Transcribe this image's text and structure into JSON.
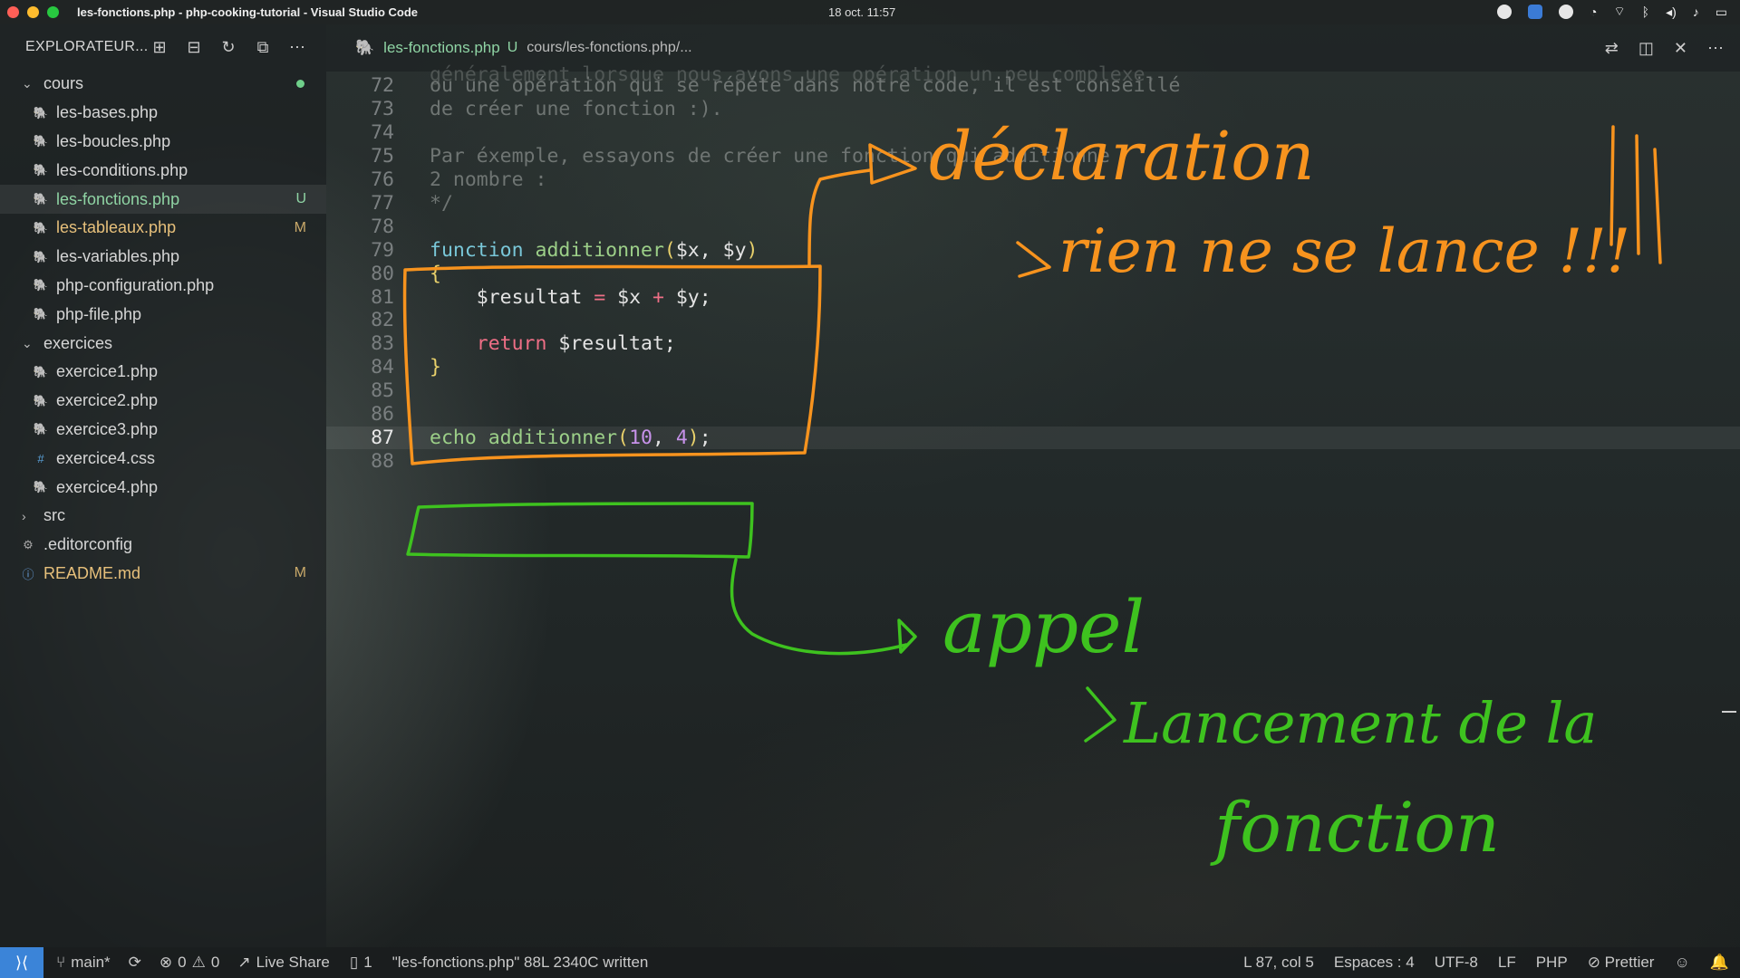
{
  "window": {
    "title": "les-fonctions.php - php-cooking-tutorial - Visual Studio Code",
    "clock": "18 oct.  11:57",
    "traffic_colors": [
      "#ff5f57",
      "#febc2e",
      "#28c840"
    ]
  },
  "sidebar": {
    "header": "EXPLORATEUR...",
    "actions": [
      "new-file-icon",
      "new-folder-icon",
      "refresh-icon",
      "collapse-icon",
      "more-icon"
    ],
    "folders": [
      {
        "name": "cours",
        "expanded": true,
        "files": [
          {
            "name": "les-bases.php",
            "type": "php",
            "badge": ""
          },
          {
            "name": "les-boucles.php",
            "type": "php",
            "badge": ""
          },
          {
            "name": "les-conditions.php",
            "type": "php",
            "badge": ""
          },
          {
            "name": "les-fonctions.php",
            "type": "php",
            "badge": "U"
          },
          {
            "name": "les-tableaux.php",
            "type": "php",
            "badge": "M"
          },
          {
            "name": "les-variables.php",
            "type": "php",
            "badge": ""
          },
          {
            "name": "php-configuration.php",
            "type": "php",
            "badge": ""
          },
          {
            "name": "php-file.php",
            "type": "php",
            "badge": ""
          }
        ]
      },
      {
        "name": "exercices",
        "expanded": true,
        "files": [
          {
            "name": "exercice1.php",
            "type": "php",
            "badge": ""
          },
          {
            "name": "exercice2.php",
            "type": "php",
            "badge": ""
          },
          {
            "name": "exercice3.php",
            "type": "php",
            "badge": ""
          },
          {
            "name": "exercice4.css",
            "type": "css",
            "badge": ""
          },
          {
            "name": "exercice4.php",
            "type": "php",
            "badge": ""
          }
        ]
      },
      {
        "name": "src",
        "expanded": false,
        "files": []
      }
    ],
    "root_files": [
      {
        "name": ".editorconfig",
        "type": "config",
        "badge": ""
      },
      {
        "name": "README.md",
        "type": "info",
        "badge": "M"
      }
    ]
  },
  "tab": {
    "name": "les-fonctions.php",
    "flag": "U",
    "path": "cours/les-fonctions.php/..."
  },
  "code": {
    "lines": [
      {
        "n": "72",
        "parts": [
          [
            "cm",
            "ou une opération qui se répéte dans notre code, il est conseillé"
          ]
        ]
      },
      {
        "n": "73",
        "parts": [
          [
            "cm",
            "de créer une fonction :)."
          ]
        ]
      },
      {
        "n": "74",
        "parts": []
      },
      {
        "n": "75",
        "parts": [
          [
            "cm",
            "Par éxemple, essayons de créer une fonction qui additionne"
          ]
        ]
      },
      {
        "n": "76",
        "parts": [
          [
            "cm",
            "2 nombre :"
          ]
        ]
      },
      {
        "n": "77",
        "parts": [
          [
            "cm",
            "*/"
          ]
        ]
      },
      {
        "n": "78",
        "parts": []
      },
      {
        "n": "79",
        "parts": [
          [
            "kw",
            "function "
          ],
          [
            "fn",
            "additionner"
          ],
          [
            "br",
            "("
          ],
          [
            "var",
            "$x, $y"
          ],
          [
            "br",
            ")"
          ]
        ]
      },
      {
        "n": "80",
        "parts": [
          [
            "br",
            "{"
          ]
        ]
      },
      {
        "n": "81",
        "parts": [
          [
            "pl",
            "    "
          ],
          [
            "var",
            "$resultat "
          ],
          [
            "op",
            "="
          ],
          [
            "var",
            " $x "
          ],
          [
            "op",
            "+"
          ],
          [
            "var",
            " $y;"
          ]
        ]
      },
      {
        "n": "82",
        "parts": []
      },
      {
        "n": "83",
        "parts": [
          [
            "pl",
            "    "
          ],
          [
            "ret",
            "return "
          ],
          [
            "var",
            "$resultat;"
          ]
        ]
      },
      {
        "n": "84",
        "parts": [
          [
            "br",
            "}"
          ]
        ]
      },
      {
        "n": "85",
        "parts": []
      },
      {
        "n": "86",
        "parts": []
      },
      {
        "n": "87",
        "parts": [
          [
            "fn",
            "echo additionner"
          ],
          [
            "br",
            "("
          ],
          [
            "num",
            "10"
          ],
          [
            "pl",
            ", "
          ],
          [
            "num",
            "4"
          ],
          [
            "br",
            ")"
          ],
          [
            "pl",
            ";"
          ]
        ],
        "current": true
      },
      {
        "n": "88",
        "parts": []
      }
    ],
    "partial_top": "généralement lorsque nous avons une opération un peu complexe,"
  },
  "annotations": {
    "declaration_title": "déclaration",
    "declaration_sub": "rien ne se lance !!!",
    "call_title": "appel",
    "call_sub1": "Lancement de la",
    "call_sub2": "fonction",
    "orange": "#f7931e",
    "green": "#3ec21f"
  },
  "statusbar": {
    "branch": "main*",
    "errors": "0",
    "warnings": "0",
    "live_share": "Live Share",
    "tasks": "1",
    "message": "\"les-fonctions.php\" 88L 2340C written",
    "position": "L 87, col 5",
    "spaces": "Espaces : 4",
    "encoding": "UTF-8",
    "eol": "LF",
    "language": "PHP",
    "formatter": "Prettier"
  }
}
